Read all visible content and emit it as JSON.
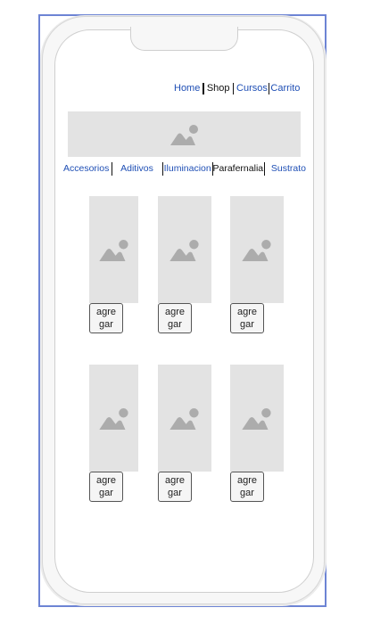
{
  "top_nav": {
    "home": "Home",
    "shop": "Shop",
    "cursos": "Cursos",
    "carrito": "Carrito"
  },
  "banner": {
    "icon": "image-placeholder-icon"
  },
  "category_nav": {
    "accesorios": "Accesorios",
    "aditivos": "Aditivos",
    "iluminacion": "Iluminacion",
    "parafernalia": "Parafernalia",
    "sustrato": "Sustrato"
  },
  "products": [
    {
      "image_icon": "image-placeholder-icon",
      "button_label": "agre\ngar"
    },
    {
      "image_icon": "image-placeholder-icon",
      "button_label": "agre\ngar"
    },
    {
      "image_icon": "image-placeholder-icon",
      "button_label": "agre\ngar"
    },
    {
      "image_icon": "image-placeholder-icon",
      "button_label": "agre\ngar"
    },
    {
      "image_icon": "image-placeholder-icon",
      "button_label": "agre\ngar"
    },
    {
      "image_icon": "image-placeholder-icon",
      "button_label": "agre\ngar"
    }
  ],
  "colors": {
    "link": "#1f4fb5",
    "placeholder_bg": "#e3e3e3",
    "placeholder_icon": "#acacac",
    "frame_border": "#6d84d4"
  }
}
